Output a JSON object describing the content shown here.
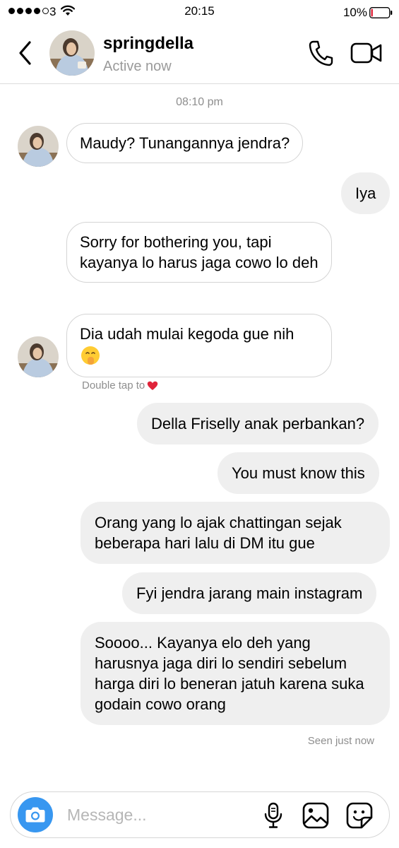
{
  "status_bar": {
    "carrier": "3",
    "time": "20:15",
    "battery_percent": "10%",
    "battery_level": 0.1,
    "battery_color": "#e0243a",
    "signal_bars_filled": 4,
    "signal_bars_total": 5
  },
  "header": {
    "back_icon": "chevron-left-icon",
    "username": "springdella",
    "status": "Active now",
    "call_icon": "phone-icon",
    "video_icon": "video-camera-icon"
  },
  "thread": {
    "timestamp": "08:10 pm",
    "messages": [
      {
        "direction": "incoming",
        "text": "Maudy? Tunangannya jendra?"
      },
      {
        "direction": "outgoing",
        "text": "Iya"
      },
      {
        "direction": "incoming",
        "text": "Sorry for bothering you, tapi kayanya lo harus jaga cowo lo deh"
      },
      {
        "direction": "incoming",
        "text": "Dia udah mulai kegoda gue nih",
        "emoji": "shushing-face-emoji"
      },
      {
        "direction": "outgoing",
        "text": "Della Friselly anak perbankan?"
      },
      {
        "direction": "outgoing",
        "text": "You must know this"
      },
      {
        "direction": "outgoing",
        "text": "Orang yang lo ajak chattingan sejak beberapa hari lalu di DM itu gue"
      },
      {
        "direction": "outgoing",
        "text": "Fyi jendra jarang main instagram"
      },
      {
        "direction": "outgoing",
        "text": "Soooo... Kayanya elo deh yang harusnya jaga diri lo sendiri sebelum harga diri lo beneran jatuh karena suka godain cowo orang"
      }
    ],
    "double_tap_hint": "Double tap to",
    "double_tap_icon": "red-heart-icon",
    "seen_text": "Seen just now"
  },
  "composer": {
    "camera_icon": "camera-icon",
    "placeholder": "Message...",
    "mic_icon": "microphone-icon",
    "gallery_icon": "image-gallery-icon",
    "sticker_icon": "sticker-icon",
    "accent_color": "#3897f0"
  }
}
